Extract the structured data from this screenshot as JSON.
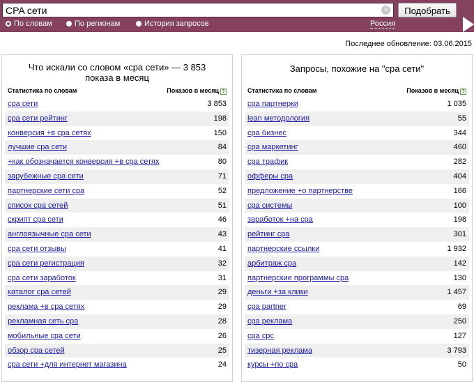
{
  "search": {
    "query": "CPA сети",
    "submit_label": "Подобрать",
    "clear_glyph": "×"
  },
  "modes": [
    {
      "label": "По словам",
      "selected": true
    },
    {
      "label": "По регионам",
      "selected": false
    },
    {
      "label": "История запросов",
      "selected": false
    }
  ],
  "region": "Россия",
  "last_update": "Последнее обновление: 03.06.2015",
  "colors": {
    "accent": "#85425f",
    "link": "#1a1aa6",
    "row_alt": "#efefef"
  },
  "left_panel": {
    "title_line1": "Что искали со словом «cpa сети» — 3 853",
    "title_line2": "показа в месяц",
    "col_keyword": "Статистика по словам",
    "col_count": "Показов в месяц",
    "help_icon": "?",
    "rows": [
      {
        "keyword": "cpa сети",
        "count": "3 853"
      },
      {
        "keyword": "cpa сети рейтинг",
        "count": "198"
      },
      {
        "keyword": "конверсия +в cpa сетях",
        "count": "150"
      },
      {
        "keyword": "лучшие cpa сети",
        "count": "84"
      },
      {
        "keyword": "+как обозначается конверсия +в cpa сетях",
        "count": "80"
      },
      {
        "keyword": "зарубежные cpa сети",
        "count": "71"
      },
      {
        "keyword": "партнерские сети cpa",
        "count": "52"
      },
      {
        "keyword": "список cpa сетей",
        "count": "51"
      },
      {
        "keyword": "скрипт cpa сети",
        "count": "46"
      },
      {
        "keyword": "англоязычные cpa сети",
        "count": "43"
      },
      {
        "keyword": "cpa сети отзывы",
        "count": "41"
      },
      {
        "keyword": "cpa сети регистрация",
        "count": "32"
      },
      {
        "keyword": "cpa сети заработок",
        "count": "31"
      },
      {
        "keyword": "каталог cpa сетей",
        "count": "29"
      },
      {
        "keyword": "реклама +в cpa сетях",
        "count": "29"
      },
      {
        "keyword": "рекламная сеть cpa",
        "count": "28"
      },
      {
        "keyword": "мобильные cpa сети",
        "count": "26"
      },
      {
        "keyword": "обзор cpa сетей",
        "count": "25"
      },
      {
        "keyword": "cpa сети +для интернет магазина",
        "count": "24"
      }
    ]
  },
  "right_panel": {
    "title": "Запросы, похожие на \"cpa сети\"",
    "col_keyword": "Статистика по словам",
    "col_count": "Показов в месяц",
    "help_icon": "?",
    "rows": [
      {
        "keyword": "cpa партнерки",
        "count": "1 035"
      },
      {
        "keyword": "lean методология",
        "count": "55"
      },
      {
        "keyword": "cpa бизнес",
        "count": "344"
      },
      {
        "keyword": "cpa маркетинг",
        "count": "460"
      },
      {
        "keyword": "cpa трафик",
        "count": "282"
      },
      {
        "keyword": "офферы cpa",
        "count": "404"
      },
      {
        "keyword": "предложение +о партнерстве",
        "count": "166"
      },
      {
        "keyword": "cpa системы",
        "count": "100"
      },
      {
        "keyword": "заработок +на cpa",
        "count": "198"
      },
      {
        "keyword": "рейтинг cpa",
        "count": "301"
      },
      {
        "keyword": "партнерские ссылки",
        "count": "1 932"
      },
      {
        "keyword": "арбитраж cpa",
        "count": "142"
      },
      {
        "keyword": "партнерские программы cpa",
        "count": "130"
      },
      {
        "keyword": "деньги +за клики",
        "count": "1 457"
      },
      {
        "keyword": "cpa partner",
        "count": "69"
      },
      {
        "keyword": "cpa реклама",
        "count": "250"
      },
      {
        "keyword": "cpa cpc",
        "count": "127"
      },
      {
        "keyword": "тизерная реклама",
        "count": "3 793"
      },
      {
        "keyword": "курсы +по cpa",
        "count": "50"
      }
    ]
  }
}
